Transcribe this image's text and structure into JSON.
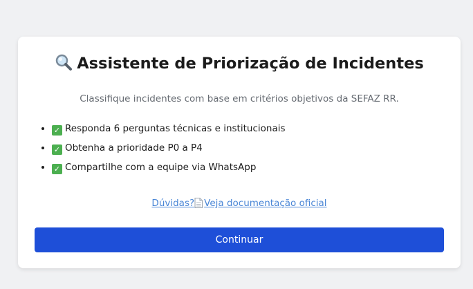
{
  "card": {
    "title": "Assistente de Priorização de Incidentes",
    "title_icon": "magnifying-glass-icon",
    "subtitle": "Classifique incidentes com base em critérios objetivos da SEFAZ RR.",
    "features": [
      {
        "icon": "check-mark-icon",
        "text": "Responda 6 perguntas técnicas e institucionais"
      },
      {
        "icon": "check-mark-icon",
        "text": "Obtenha a prioridade P0 a P4"
      },
      {
        "icon": "check-mark-icon",
        "text": "Compartilhe com a equipe via WhatsApp"
      }
    ],
    "help_link": {
      "prefix": "Dúvidas?",
      "icon": "document-icon",
      "text": "Veja documentação oficial"
    },
    "continue_label": "Continuar"
  },
  "colors": {
    "background": "#f0f1f3",
    "card": "#ffffff",
    "accent": "#1e4fd8",
    "link": "#4a86d6",
    "check": "#4caf50"
  }
}
